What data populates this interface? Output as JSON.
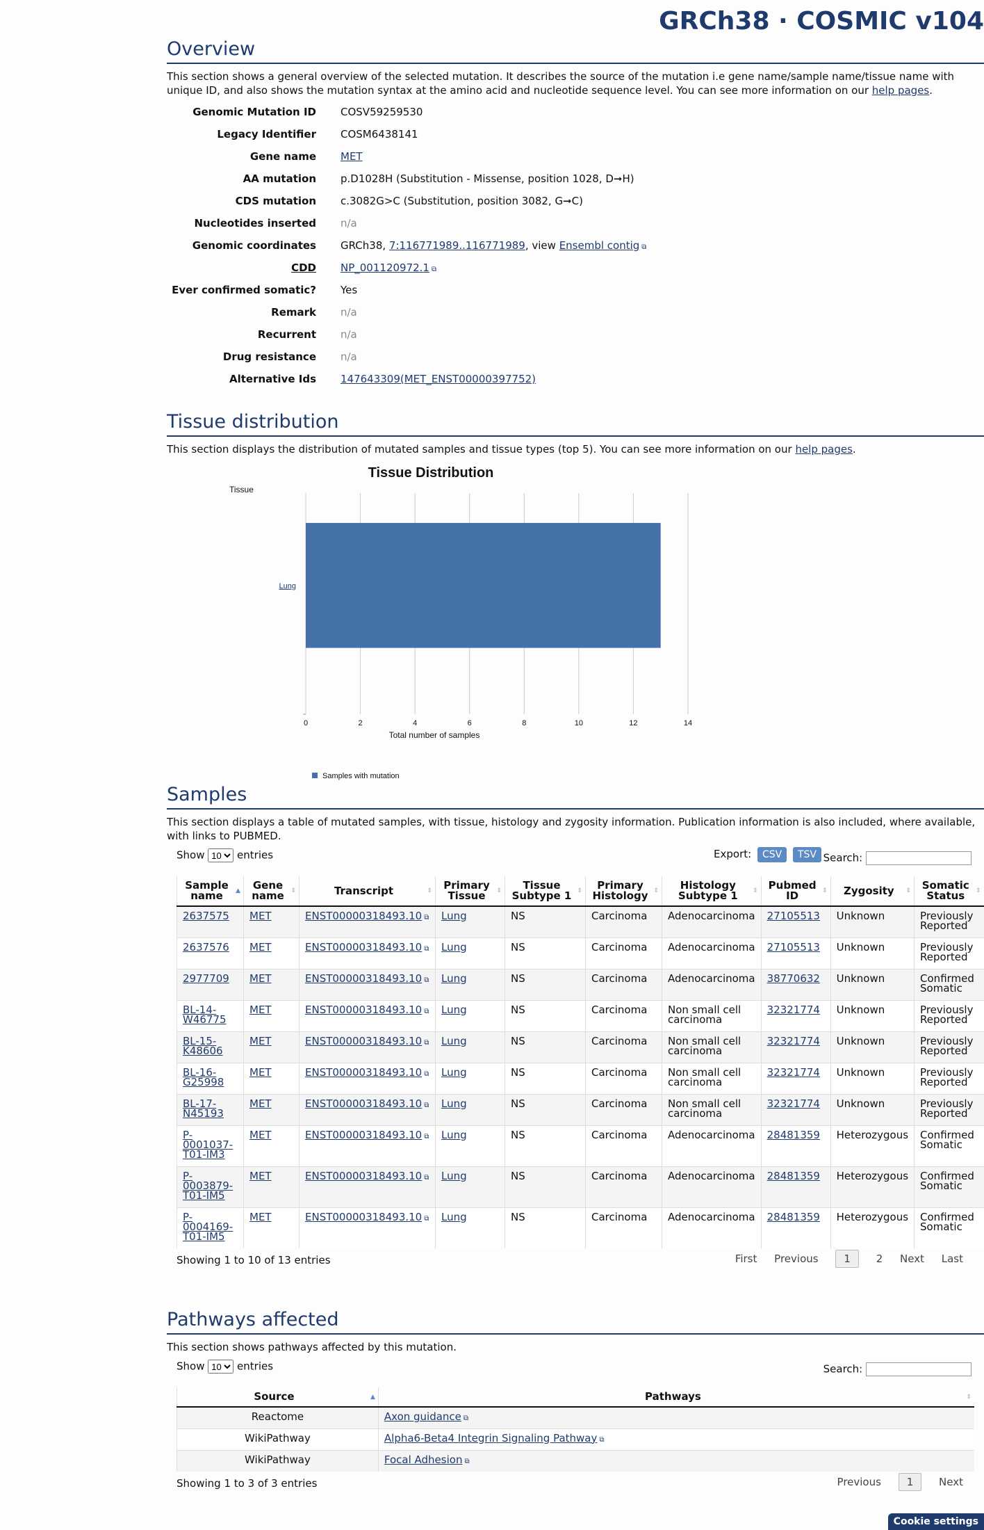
{
  "brand": "GRCh38 · COSMIC v104",
  "overview": {
    "title": "Overview",
    "desc_prefix": "This section shows a general overview of the selected mutation. It describes the source of the mutation i.e gene name/sample name/tissue name with unique ID, and also shows the mutation syntax at the amino acid and nucleotide sequence level. You can see more information on our ",
    "help_link": "help pages",
    "desc_suffix": ".",
    "rows": {
      "genomic_mutation_id": {
        "label": "Genomic Mutation ID",
        "value": "COSV59259530"
      },
      "legacy_identifier": {
        "label": "Legacy Identifier",
        "value": "COSM6438141"
      },
      "gene_name": {
        "label": "Gene name",
        "value": "MET"
      },
      "aa_mutation": {
        "label": "AA mutation",
        "value": "p.D1028H (Substitution - Missense, position 1028, D➞H)"
      },
      "cds_mutation": {
        "label": "CDS mutation",
        "value": "c.3082G>C (Substitution, position 3082, G➞C)"
      },
      "nucleotides_inserted": {
        "label": "Nucleotides inserted",
        "value": "n/a"
      },
      "genomic_coordinates": {
        "label": "Genomic coordinates",
        "prefix": "GRCh38, ",
        "coord_link": "7:116771989..116771989",
        "middle": ", view ",
        "ensembl_link": "Ensembl contig"
      },
      "cdd": {
        "label": "CDD",
        "value": "NP_001120972.1"
      },
      "ever_confirmed_somatic": {
        "label": "Ever confirmed somatic?",
        "value": "Yes"
      },
      "remark": {
        "label": "Remark",
        "value": "n/a"
      },
      "recurrent": {
        "label": "Recurrent",
        "value": "n/a"
      },
      "drug_resistance": {
        "label": "Drug resistance",
        "value": "n/a"
      },
      "alternative_ids": {
        "label": "Alternative Ids",
        "value": "147643309(MET_ENST00000397752)"
      }
    }
  },
  "tissue": {
    "title": "Tissue distribution",
    "desc_prefix": "This section displays the distribution of mutated samples and tissue types (top 5). You can see more information on our ",
    "help_link": "help pages",
    "desc_suffix": "."
  },
  "chart_data": {
    "type": "bar",
    "orientation": "horizontal",
    "title": "Tissue Distribution",
    "ylabel": "Tissue",
    "xlabel": "Total number of samples",
    "categories": [
      "Lung"
    ],
    "series": [
      {
        "name": "Samples with mutation",
        "values": [
          13
        ]
      }
    ],
    "xlim": [
      0,
      14
    ],
    "xticks": [
      0,
      2,
      4,
      6,
      8,
      10,
      12,
      14
    ],
    "grid": true,
    "legend_position": "bottom-left",
    "colors": {
      "bar": "#4472a8"
    }
  },
  "samples": {
    "title": "Samples",
    "desc": "This section displays a table of mutated samples, with tissue, histology and zygosity information. Publication information is also included, where available, with links to PUBMED.",
    "show_label": "Show",
    "entries_label": "entries",
    "length_value": "10",
    "export_label": "Export:",
    "csv": "CSV",
    "tsv": "TSV",
    "search_label": "Search:",
    "columns": [
      "Sample name",
      "Gene name",
      "Transcript",
      "Primary Tissue",
      "Tissue Subtype 1",
      "Primary Histology",
      "Histology Subtype 1",
      "Pubmed ID",
      "Zygosity",
      "Somatic Status"
    ],
    "rows": [
      [
        "2637575",
        "MET",
        "ENST00000318493.10",
        "Lung",
        "NS",
        "Carcinoma",
        "Adenocarcinoma",
        "27105513",
        "Unknown",
        "Previously Reported"
      ],
      [
        "2637576",
        "MET",
        "ENST00000318493.10",
        "Lung",
        "NS",
        "Carcinoma",
        "Adenocarcinoma",
        "27105513",
        "Unknown",
        "Previously Reported"
      ],
      [
        "2977709",
        "MET",
        "ENST00000318493.10",
        "Lung",
        "NS",
        "Carcinoma",
        "Adenocarcinoma",
        "38770632",
        "Unknown",
        "Confirmed Somatic"
      ],
      [
        "BL-14-W46775",
        "MET",
        "ENST00000318493.10",
        "Lung",
        "NS",
        "Carcinoma",
        "Non small cell carcinoma",
        "32321774",
        "Unknown",
        "Previously Reported"
      ],
      [
        "BL-15-K48606",
        "MET",
        "ENST00000318493.10",
        "Lung",
        "NS",
        "Carcinoma",
        "Non small cell carcinoma",
        "32321774",
        "Unknown",
        "Previously Reported"
      ],
      [
        "BL-16-G25998",
        "MET",
        "ENST00000318493.10",
        "Lung",
        "NS",
        "Carcinoma",
        "Non small cell carcinoma",
        "32321774",
        "Unknown",
        "Previously Reported"
      ],
      [
        "BL-17-N45193",
        "MET",
        "ENST00000318493.10",
        "Lung",
        "NS",
        "Carcinoma",
        "Non small cell carcinoma",
        "32321774",
        "Unknown",
        "Previously Reported"
      ],
      [
        "P-0001037-T01-IM3",
        "MET",
        "ENST00000318493.10",
        "Lung",
        "NS",
        "Carcinoma",
        "Adenocarcinoma",
        "28481359",
        "Heterozygous",
        "Confirmed Somatic"
      ],
      [
        "P-0003879-T01-IM5",
        "MET",
        "ENST00000318493.10",
        "Lung",
        "NS",
        "Carcinoma",
        "Adenocarcinoma",
        "28481359",
        "Heterozygous",
        "Confirmed Somatic"
      ],
      [
        "P-0004169-T01-IM5",
        "MET",
        "ENST00000318493.10",
        "Lung",
        "NS",
        "Carcinoma",
        "Adenocarcinoma",
        "28481359",
        "Heterozygous",
        "Confirmed Somatic"
      ]
    ],
    "info": "Showing 1 to 10 of 13 entries",
    "pager": {
      "first": "First",
      "previous": "Previous",
      "page1": "1",
      "page2": "2",
      "next": "Next",
      "last": "Last"
    }
  },
  "pathways": {
    "title": "Pathways affected",
    "desc": "This section shows pathways affected by this mutation.",
    "show_label": "Show",
    "entries_label": "entries",
    "length_value": "10",
    "search_label": "Search:",
    "columns": [
      "Source",
      "Pathways"
    ],
    "rows": [
      [
        "Reactome",
        "Axon guidance"
      ],
      [
        "WikiPathway",
        "Alpha6-Beta4 Integrin Signaling Pathway"
      ],
      [
        "WikiPathway",
        "Focal Adhesion"
      ]
    ],
    "info": "Showing 1 to 3 of 3 entries",
    "pager": {
      "previous": "Previous",
      "page1": "1",
      "next": "Next"
    }
  },
  "cookie": "Cookie settings"
}
